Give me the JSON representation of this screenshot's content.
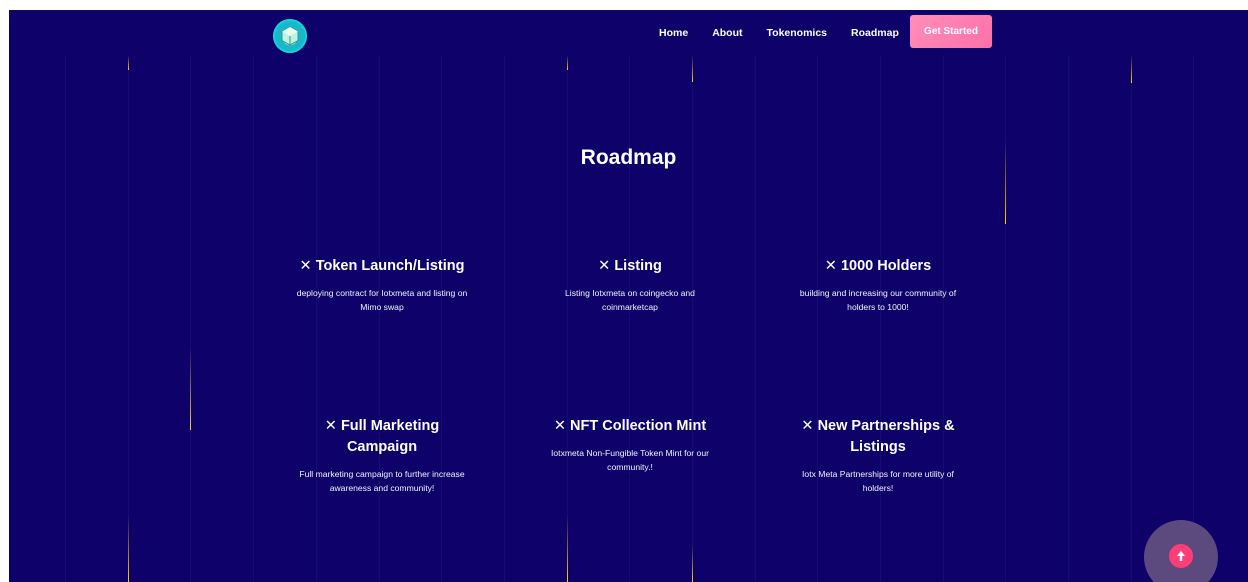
{
  "header": {
    "logo_icon": "iotx-meta-logo-icon",
    "nav": [
      {
        "label": "Home"
      },
      {
        "label": "About"
      },
      {
        "label": "Tokenomics"
      },
      {
        "label": "Roadmap"
      }
    ],
    "cta_label": "Get Started"
  },
  "roadmap": {
    "title": "Roadmap",
    "items": [
      {
        "title": "✕ Token Launch/Listing",
        "description": "deploying contract for Iotxmeta and listing on Mimo swap"
      },
      {
        "title": "✕ Listing",
        "description": "Listing Iotxmeta on coingecko and coinmarketcap"
      },
      {
        "title": "✕ 1000 Holders",
        "description": "building and increasing our community of holders to 1000!"
      },
      {
        "title": "✕ Full Marketing Campaign",
        "description": "Full marketing campaign to further increase awareness and community!"
      },
      {
        "title": "✕ NFT Collection Mint",
        "description": "Iotxmeta Non-Fungible Token Mint for our community.!"
      },
      {
        "title": "✕ New Partnerships & Listings",
        "description": "Iotx Meta Partnerships for more utility of holders!"
      }
    ]
  },
  "scroll_top": {
    "icon": "arrow-up-icon"
  },
  "colors": {
    "background": "#0e0169",
    "cta": "#ff7fb0",
    "accent_line": "#ffd600",
    "scroll_button": "#ff3e78"
  }
}
